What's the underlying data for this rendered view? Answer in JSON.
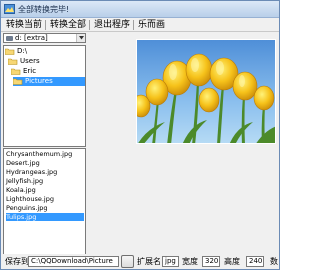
{
  "window": {
    "title": "全部转换完毕!"
  },
  "toolbar": {
    "buttons": [
      {
        "label": "转换当前"
      },
      {
        "label": "转换全部"
      },
      {
        "label": "退出程序"
      },
      {
        "label": "乐而画"
      }
    ]
  },
  "drive": {
    "value": "d: [extra]"
  },
  "folder_tree": {
    "items": [
      {
        "label": "D:\\"
      },
      {
        "label": "Users"
      },
      {
        "label": "Eric"
      },
      {
        "label": "Pictures",
        "selected": true
      }
    ]
  },
  "file_list": {
    "items": [
      {
        "label": "Chrysanthemum.jpg"
      },
      {
        "label": "Desert.jpg"
      },
      {
        "label": "Hydrangeas.jpg"
      },
      {
        "label": "Jellyfish.jpg"
      },
      {
        "label": "Koala.jpg"
      },
      {
        "label": "Lighthouse.jpg"
      },
      {
        "label": "Penguins.jpg"
      },
      {
        "label": "Tulips.jpg",
        "selected": true
      }
    ]
  },
  "statusbar": {
    "save_dir_label": "保存到",
    "save_dir_value": "C:\\QQDownload\\Picture",
    "ext_label": "扩展名",
    "ext_value": "jpg",
    "width_label": "宽度",
    "width_value": "320",
    "height_label": "高度",
    "height_value": "240",
    "quantity_label": "数"
  },
  "colors": {
    "selection": "#3399ff",
    "titlebar": "#c7d9f0"
  }
}
